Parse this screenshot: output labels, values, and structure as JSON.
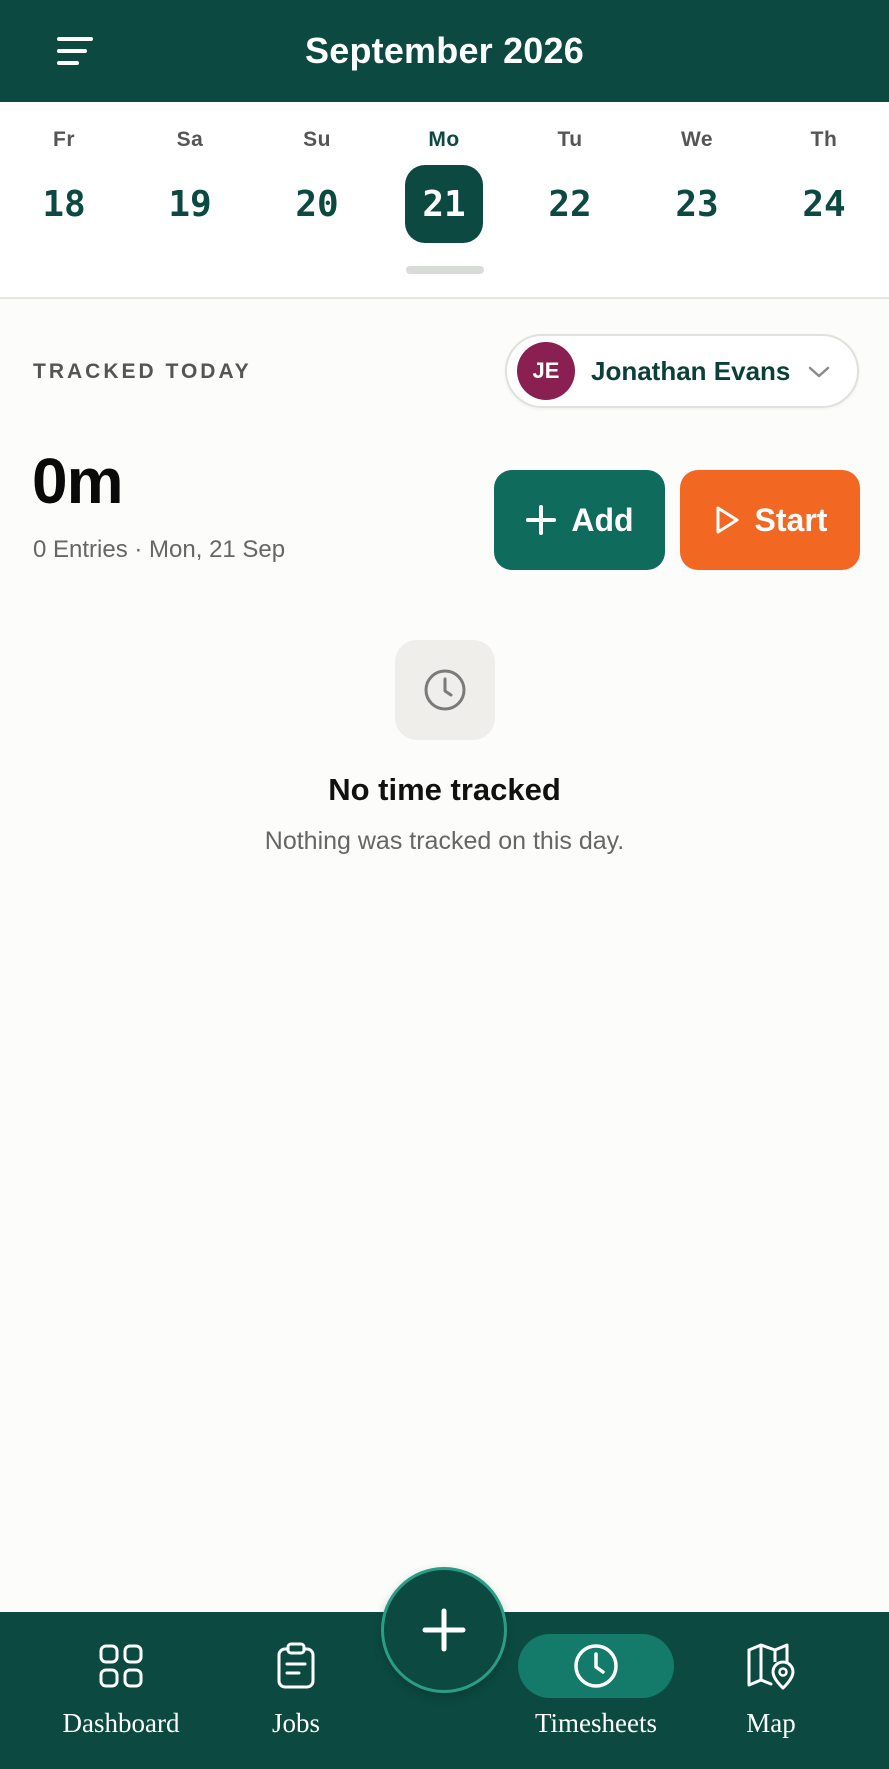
{
  "header": {
    "title": "September 2026"
  },
  "week": {
    "days": [
      {
        "name": "Fr",
        "num": "18"
      },
      {
        "name": "Sa",
        "num": "19"
      },
      {
        "name": "Su",
        "num": "20"
      },
      {
        "name": "Mo",
        "num": "21",
        "selected": true
      },
      {
        "name": "Tu",
        "num": "22"
      },
      {
        "name": "We",
        "num": "23"
      },
      {
        "name": "Th",
        "num": "24"
      }
    ]
  },
  "main": {
    "section_label": "TRACKED TODAY",
    "user": {
      "initials": "JE",
      "name": "Jonathan Evans"
    },
    "total": "0m",
    "entries": "0 Entries · Mon, 21 Sep",
    "add_label": "Add",
    "start_label": "Start",
    "empty_title": "No time tracked",
    "empty_subtitle": "Nothing was tracked on this day."
  },
  "nav": {
    "items": [
      {
        "label": "Dashboard",
        "icon": "grid-icon"
      },
      {
        "label": "Jobs",
        "icon": "clipboard-icon"
      },
      {
        "label": "Timesheets",
        "icon": "clock-icon",
        "active": true
      },
      {
        "label": "Map",
        "icon": "map-pin-icon"
      }
    ],
    "fab_icon": "plus-icon"
  },
  "colors": {
    "primary": "#0c4a41",
    "accent_green": "#0f6b5c",
    "accent_orange": "#f26722",
    "avatar": "#8a1f52"
  }
}
